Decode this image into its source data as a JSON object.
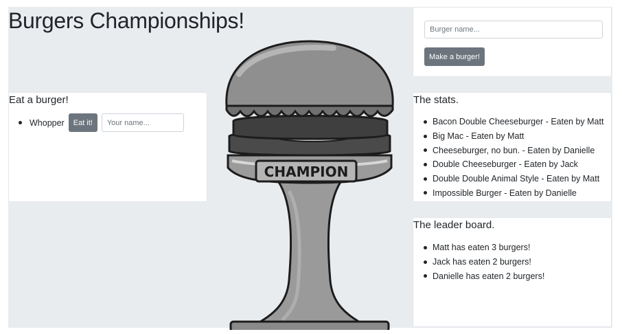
{
  "header": {
    "title": "Burgers Championships!"
  },
  "eat_panel": {
    "title": "Eat a burger!",
    "burgers": [
      {
        "name": "Whopper",
        "button_label": "Eat it!",
        "input_placeholder": "Your name..."
      }
    ]
  },
  "make_panel": {
    "input_placeholder": "Burger name...",
    "button_label": "Make a burger!"
  },
  "stats": {
    "title": "The stats.",
    "items": [
      "Bacon Double Cheeseburger - Eaten by Matt",
      "Big Mac - Eaten by Matt",
      "Cheeseburger, no bun. - Eaten by Danielle",
      "Double Cheeseburger - Eaten by Jack",
      "Double Double Animal Style - Eaten by Matt",
      "Impossible Burger - Eaten by Danielle"
    ]
  },
  "leaderboard": {
    "title": "The leader board.",
    "items": [
      "Matt has eaten 3 burgers!",
      "Jack has eaten 2 burgers!",
      "Danielle has eaten 2 burgers!"
    ]
  },
  "trophy": {
    "plaque_text": "CHAMPION"
  },
  "colors": {
    "background": "#e9ecef",
    "button": "#6c757d",
    "card": "#ffffff"
  }
}
